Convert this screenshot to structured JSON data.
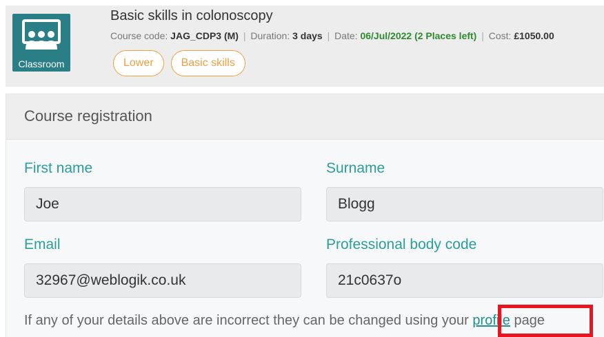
{
  "course": {
    "icon": "classroom-icon",
    "icon_label": "Classroom",
    "title": "Basic skills in colonoscopy",
    "code_label": "Course code:",
    "code_value": "JAG_CDP3 (M)",
    "duration_label": "Duration:",
    "duration_value": "3 days",
    "date_label": "Date:",
    "date_value": "06/Jul/2022 (2 Places left)",
    "cost_label": "Cost:",
    "cost_value": "£1050.00",
    "separator": "|",
    "tags": [
      "Lower",
      "Basic skills"
    ]
  },
  "registration": {
    "heading": "Course registration",
    "first_name_label": "First name",
    "first_name_value": "Joe",
    "surname_label": "Surname",
    "surname_value": "Blogg",
    "email_label": "Email",
    "email_value": "32967@weblogik.co.uk",
    "professional_code_label": "Professional body code",
    "professional_code_value": "21c0637o",
    "info_text_before": "If any of your details above are incorrect they can be changed using your",
    "info_link": "profile",
    "info_text_after": "page"
  },
  "colors": {
    "accent": "#2a9d9d",
    "icon_bg": "#2a7f86",
    "tag": "#f0a040",
    "date": "#2e8a2e",
    "highlight": "#e8141e"
  }
}
